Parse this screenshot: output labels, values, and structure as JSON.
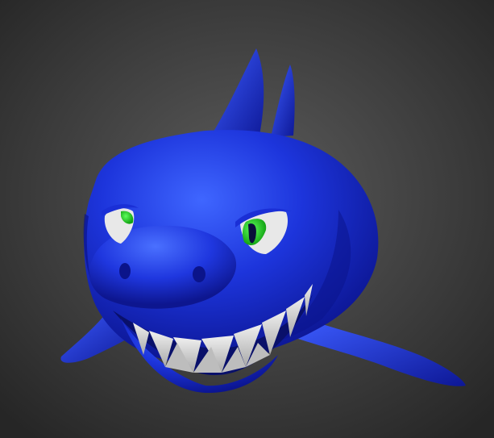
{
  "scene": {
    "subject": "shark-head-3d-model",
    "colors": {
      "background_center": "#5a5a5a",
      "background_edge": "#262626",
      "body": "#1a2fd6",
      "body_highlight": "#3f66ff",
      "body_shadow": "#0a128a",
      "eye_white": "#e8e8e8",
      "iris": "#22cc22",
      "pupil": "#0a0f3a",
      "teeth": "#d9d9d9",
      "teeth_shadow": "#9e9e9e"
    }
  }
}
